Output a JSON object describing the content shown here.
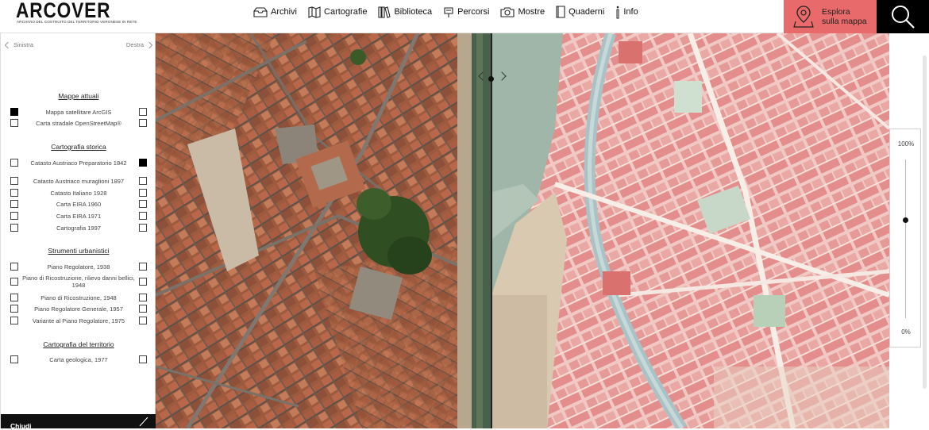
{
  "header": {
    "logo": "ARCOVER",
    "logo_subtitle": "ARCHIVIO DEL COSTRUITO DEL TERRITORIO VERONESE IN RETE",
    "nav": [
      {
        "label": "Archivi",
        "icon": "archive-box-icon"
      },
      {
        "label": "Cartografie",
        "icon": "folded-map-icon"
      },
      {
        "label": "Biblioteca",
        "icon": "books-icon"
      },
      {
        "label": "Percorsi",
        "icon": "route-sign-icon"
      },
      {
        "label": "Mostre",
        "icon": "camera-icon"
      },
      {
        "label": "Quaderni",
        "icon": "notebook-icon"
      },
      {
        "label": "Info",
        "icon": "info-icon"
      }
    ],
    "explore_line1": "Esplora",
    "explore_line2": "sulla mappa",
    "explore_color": "#e86a6a"
  },
  "sidebar": {
    "left_label": "Sinistra",
    "right_label": "Destra",
    "sections": [
      {
        "title": "Mappe attuali",
        "layers": [
          {
            "label": "Mappa satellitare ArcGIS",
            "left": true,
            "right": false
          },
          {
            "label": "Carta stradale OpenStreetMap®",
            "left": false,
            "right": false
          }
        ]
      },
      {
        "title": "Cartografia storica",
        "layers": [
          {
            "label": "Catasto Austriaco Preparatorio 1842",
            "left": false,
            "right": true
          },
          {
            "label": "Catasto Austriaco muraglioni 1897",
            "left": false,
            "right": false
          },
          {
            "label": "Catasto Italiano 1928",
            "left": false,
            "right": false
          },
          {
            "label": "Carta EIRA 1960",
            "left": false,
            "right": false
          },
          {
            "label": "Carta EIRA 1971",
            "left": false,
            "right": false
          },
          {
            "label": "Cartografia 1997",
            "left": false,
            "right": false
          }
        ]
      },
      {
        "title": "Strumenti urbanistici",
        "layers": [
          {
            "label": "Piano Regolatore, 1938",
            "left": false,
            "right": false
          },
          {
            "label": "Piano di Ricostruzione, rilievo danni bellici, 1948",
            "left": false,
            "right": false
          },
          {
            "label": "Piano di Ricostruzione, 1948",
            "left": false,
            "right": false
          },
          {
            "label": "Piano Regolatore Generale, 1957",
            "left": false,
            "right": false
          },
          {
            "label": "Variante al Piano Regolatore, 1975",
            "left": false,
            "right": false
          }
        ]
      },
      {
        "title": "Cartografia del territorio",
        "layers": [
          {
            "label": "Carta geologica, 1977",
            "left": false,
            "right": false
          }
        ]
      }
    ],
    "close_label": "Chiudi"
  },
  "opacity": {
    "max_label": "100%",
    "min_label": "0%",
    "value_fraction": 0.38
  }
}
